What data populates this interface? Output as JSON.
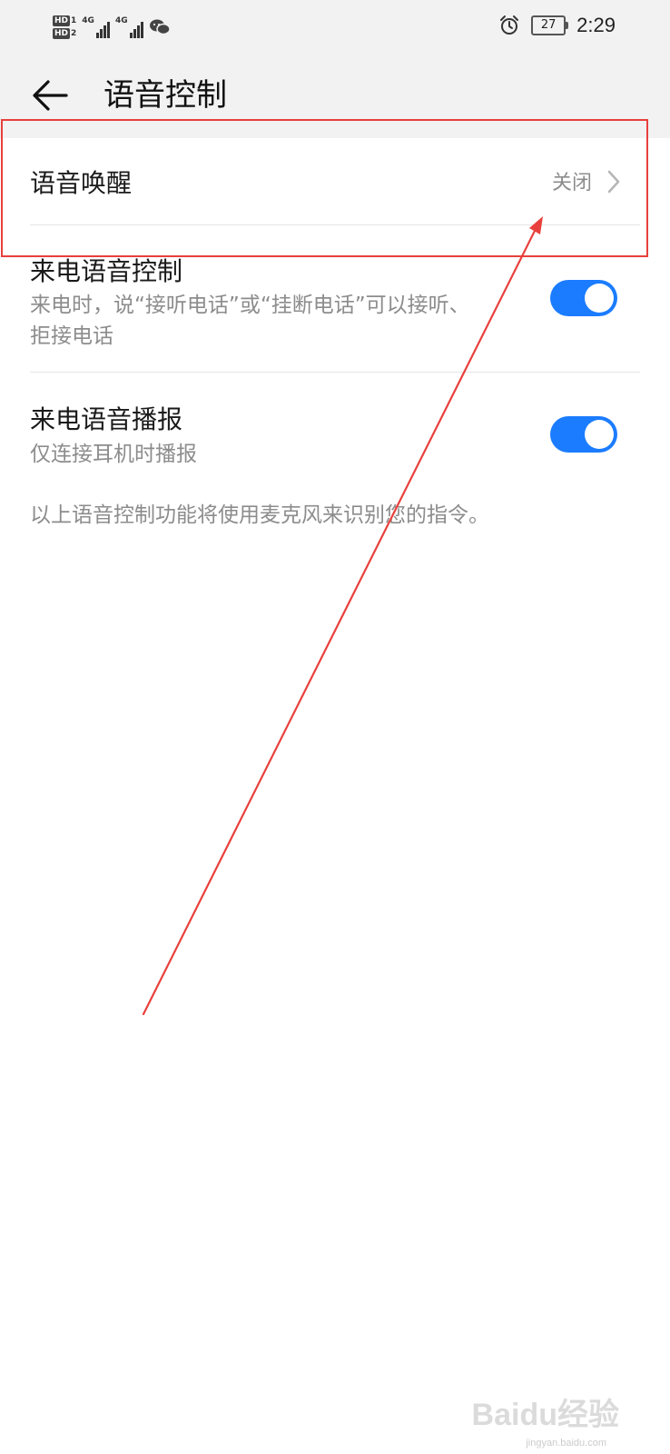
{
  "status_bar": {
    "hd1": "HD",
    "hd1_index": "1",
    "hd2": "HD",
    "hd2_index": "2",
    "network1": "4G",
    "network2": "4G",
    "battery": "27",
    "time": "2:29",
    "icons": [
      "signal-icon",
      "wechat-icon",
      "alarm-icon",
      "battery-icon"
    ]
  },
  "header": {
    "title": "语音控制",
    "back_icon": "back-arrow-icon"
  },
  "settings": {
    "voice_wakeup": {
      "label": "语音唤醒",
      "value": "关闭"
    },
    "incoming_call_voice_control": {
      "label": "来电语音控制",
      "description": "来电时，说“接听电话”或“挂断电话”可以接听、拒接电话",
      "enabled": true
    },
    "incoming_call_announcement": {
      "label": "来电语音播报",
      "description": "仅连接耳机时播报",
      "enabled": true
    }
  },
  "footnote": "以上语音控制功能将使用麦克风来识别您的指令。",
  "annotation": {
    "color": "#e8403c"
  },
  "watermark": {
    "brand": "Baidu经验",
    "url": "jingyan.baidu.com"
  },
  "colors": {
    "accent": "#1b7cff",
    "header_bg": "#f2f2f2",
    "secondary_text": "#8c8c8c"
  }
}
